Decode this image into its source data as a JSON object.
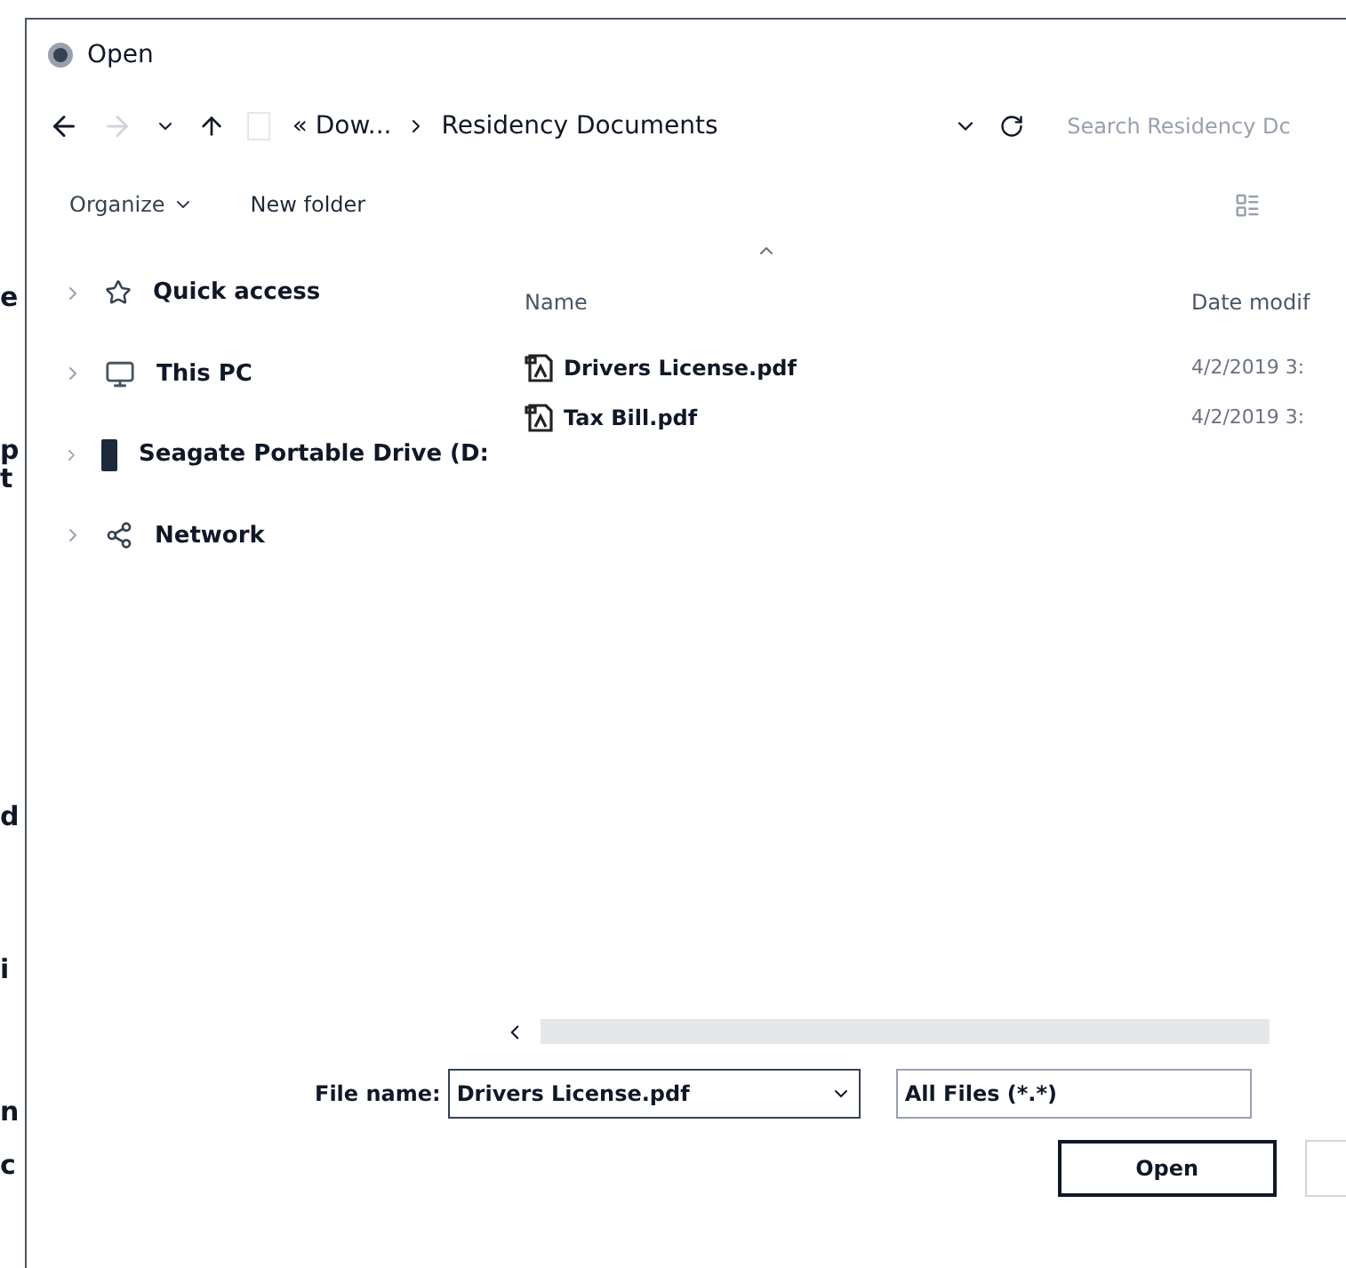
{
  "background_fragments": [
    "e",
    "p",
    "t",
    "d",
    "i",
    "n",
    "c"
  ],
  "window": {
    "title": "Open"
  },
  "address_bar": {
    "segments": [
      "« Dow...",
      "Residency Documents"
    ]
  },
  "search": {
    "placeholder": "Search Residency Dc"
  },
  "toolbar": {
    "organize": "Organize",
    "new_folder": "New folder"
  },
  "sidebar": {
    "items": [
      {
        "label": "Quick access",
        "kind": "star"
      },
      {
        "label": "This PC",
        "kind": "pc"
      },
      {
        "label": "Seagate Portable Drive (D:",
        "kind": "drive"
      },
      {
        "label": "Network",
        "kind": "network"
      }
    ]
  },
  "table": {
    "columns": [
      "Name",
      "Date modif"
    ],
    "rows": [
      {
        "name": "Drivers License.pdf",
        "date": "4/2/2019 3:",
        "selected": false
      },
      {
        "name": "Tax Bill.pdf",
        "date": "4/2/2019 3:",
        "selected": false
      }
    ]
  },
  "file_name": {
    "label": "File name:",
    "value": "Drivers License.pdf"
  },
  "file_type": {
    "value": "All Files (*.*)"
  },
  "buttons": [
    "Open"
  ]
}
